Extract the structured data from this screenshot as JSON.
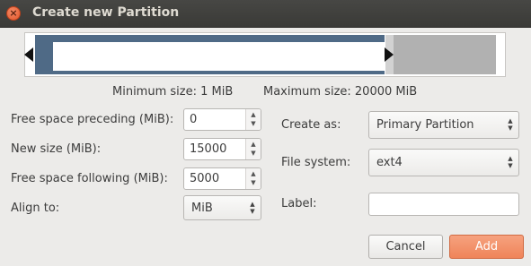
{
  "window": {
    "title": "Create new Partition",
    "close_glyph": "×"
  },
  "size_info": {
    "minimum": "Minimum size: 1 MiB",
    "maximum": "Maximum size: 20000 MiB"
  },
  "left": {
    "free_preceding": {
      "label": "Free space preceding (MiB):",
      "value": "0"
    },
    "new_size": {
      "label": "New size (MiB):",
      "value": "15000"
    },
    "free_following": {
      "label": "Free space following (MiB):",
      "value": "5000"
    },
    "align_to": {
      "label": "Align to:",
      "value": "MiB"
    }
  },
  "right": {
    "create_as": {
      "label": "Create as:",
      "value": "Primary Partition"
    },
    "file_system": {
      "label": "File system:",
      "value": "ext4"
    },
    "partition_label": {
      "label": "Label:",
      "value": ""
    }
  },
  "buttons": {
    "cancel": "Cancel",
    "add": "Add"
  },
  "icons": {
    "close": "close-icon",
    "spin_up": "▲",
    "spin_down": "▼"
  },
  "colors": {
    "accent": "#ef8459",
    "partition": "#4f6a86",
    "unallocated": "#b1b1b1"
  }
}
